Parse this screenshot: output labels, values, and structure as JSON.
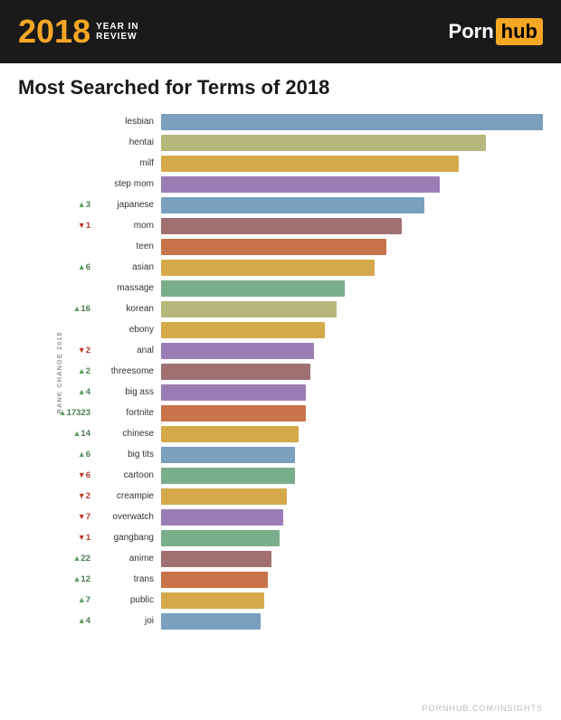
{
  "header": {
    "year": "2018",
    "year_sub_line1": "YEAR IN",
    "year_sub_line2": "REVIEW",
    "logo_porn": "Porn",
    "logo_hub": "hub",
    "logo_url": "PORNHUB.COM/INSIGHTS"
  },
  "chart": {
    "title": "Most Searched for Terms of 2018",
    "rank_change_label": "RANK CHANGE 2018",
    "bars": [
      {
        "label": "lesbian",
        "rank_change": "",
        "direction": "none",
        "width_pct": 100,
        "color": "#7a9fbf"
      },
      {
        "label": "hentai",
        "rank_change": "",
        "direction": "none",
        "width_pct": 85,
        "color": "#b5b87a"
      },
      {
        "label": "milf",
        "rank_change": "",
        "direction": "none",
        "width_pct": 78,
        "color": "#d4a94a"
      },
      {
        "label": "step mom",
        "rank_change": "",
        "direction": "none",
        "width_pct": 73,
        "color": "#9b7db5"
      },
      {
        "label": "japanese",
        "rank_change": "3",
        "direction": "up",
        "width_pct": 69,
        "color": "#7a9fbf"
      },
      {
        "label": "mom",
        "rank_change": "1",
        "direction": "down",
        "width_pct": 63,
        "color": "#a07070"
      },
      {
        "label": "teen",
        "rank_change": "",
        "direction": "none",
        "width_pct": 59,
        "color": "#c8734a"
      },
      {
        "label": "asian",
        "rank_change": "6",
        "direction": "up",
        "width_pct": 56,
        "color": "#d4a94a"
      },
      {
        "label": "massage",
        "rank_change": "",
        "direction": "none",
        "width_pct": 48,
        "color": "#7aad8a"
      },
      {
        "label": "korean",
        "rank_change": "16",
        "direction": "up",
        "width_pct": 46,
        "color": "#b5b87a"
      },
      {
        "label": "ebony",
        "rank_change": "",
        "direction": "none",
        "width_pct": 43,
        "color": "#d4a94a"
      },
      {
        "label": "anal",
        "rank_change": "2",
        "direction": "down",
        "width_pct": 40,
        "color": "#9b7db5"
      },
      {
        "label": "threesome",
        "rank_change": "2",
        "direction": "up",
        "width_pct": 39,
        "color": "#a07070"
      },
      {
        "label": "big ass",
        "rank_change": "4",
        "direction": "up",
        "width_pct": 38,
        "color": "#9b7db5"
      },
      {
        "label": "fortnite",
        "rank_change": "17323",
        "direction": "up",
        "width_pct": 38,
        "color": "#c8734a"
      },
      {
        "label": "chinese",
        "rank_change": "14",
        "direction": "up",
        "width_pct": 36,
        "color": "#d4a94a"
      },
      {
        "label": "big tits",
        "rank_change": "6",
        "direction": "up",
        "width_pct": 35,
        "color": "#7a9fbf"
      },
      {
        "label": "cartoon",
        "rank_change": "6",
        "direction": "down",
        "width_pct": 35,
        "color": "#7aad8a"
      },
      {
        "label": "creampie",
        "rank_change": "2",
        "direction": "down",
        "width_pct": 33,
        "color": "#d4a94a"
      },
      {
        "label": "overwatch",
        "rank_change": "7",
        "direction": "down",
        "width_pct": 32,
        "color": "#9b7db5"
      },
      {
        "label": "gangbang",
        "rank_change": "1",
        "direction": "down",
        "width_pct": 31,
        "color": "#7aad8a"
      },
      {
        "label": "anime",
        "rank_change": "22",
        "direction": "up",
        "width_pct": 29,
        "color": "#a07070"
      },
      {
        "label": "trans",
        "rank_change": "12",
        "direction": "up",
        "width_pct": 28,
        "color": "#c8734a"
      },
      {
        "label": "public",
        "rank_change": "7",
        "direction": "up",
        "width_pct": 27,
        "color": "#d4a94a"
      },
      {
        "label": "joi",
        "rank_change": "4",
        "direction": "up",
        "width_pct": 26,
        "color": "#7a9fbf"
      }
    ]
  },
  "footer": {
    "url": "PORNHUB.COM/INSIGHTS"
  }
}
